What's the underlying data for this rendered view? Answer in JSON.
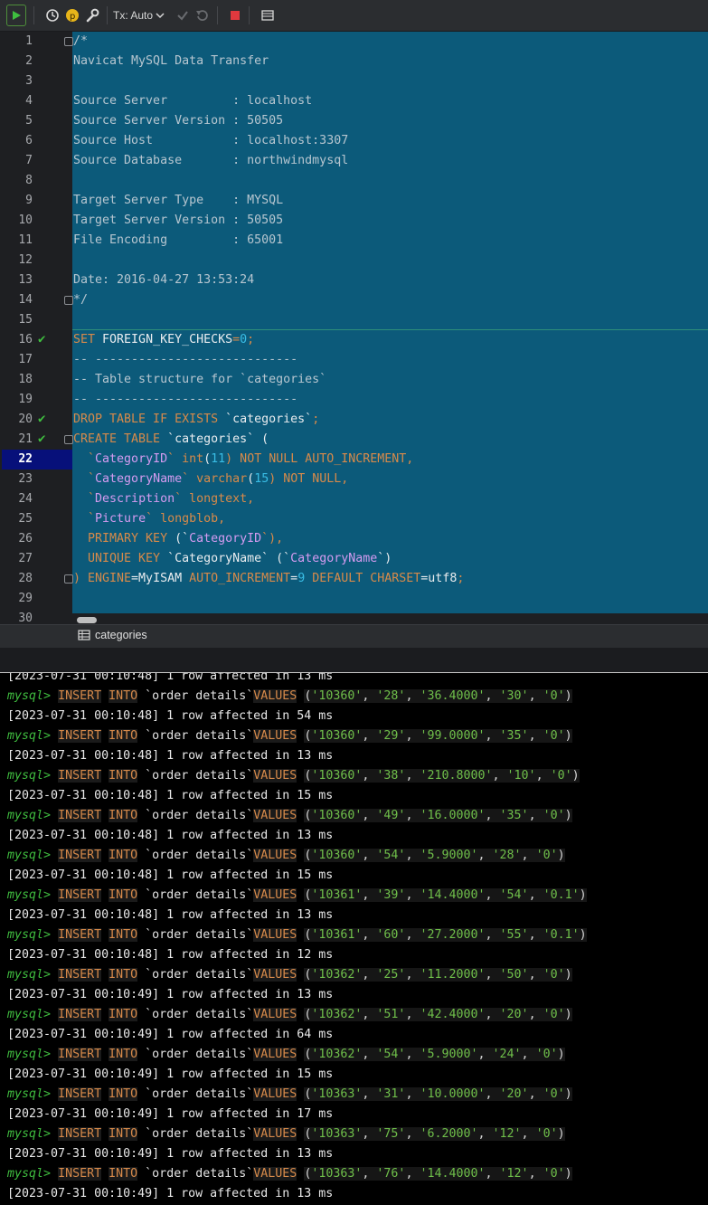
{
  "toolbar": {
    "tx_label": "Tx: Auto",
    "icons": [
      "run-icon",
      "history-icon",
      "p-icon",
      "wrench-icon",
      "chevron-down-icon",
      "commit-icon",
      "rollback-icon",
      "stop-icon",
      "table-icon"
    ]
  },
  "editor": {
    "line_numbers": [
      "1",
      "2",
      "3",
      "4",
      "5",
      "6",
      "7",
      "8",
      "9",
      "10",
      "11",
      "12",
      "13",
      "14",
      "15",
      "16",
      "17",
      "18",
      "19",
      "20",
      "21",
      "22",
      "23",
      "24",
      "25",
      "26",
      "27",
      "28",
      "29",
      "30"
    ],
    "current_line": "22",
    "lines": [
      [
        {
          "t": "/*",
          "c": "cm"
        }
      ],
      [
        {
          "t": "Navicat MySQL Data Transfer",
          "c": "cm"
        }
      ],
      [],
      [
        {
          "t": "Source Server         : localhost",
          "c": "cm"
        }
      ],
      [
        {
          "t": "Source Server Version : 50505",
          "c": "cm"
        }
      ],
      [
        {
          "t": "Source Host           : localhost:3307",
          "c": "cm"
        }
      ],
      [
        {
          "t": "Source Database       : northwindmysql",
          "c": "cm"
        }
      ],
      [],
      [
        {
          "t": "Target Server Type    : MYSQL",
          "c": "cm"
        }
      ],
      [
        {
          "t": "Target Server Version : 50505",
          "c": "cm"
        }
      ],
      [
        {
          "t": "File Encoding         : 65001",
          "c": "cm"
        }
      ],
      [],
      [
        {
          "t": "Date: 2016-04-27 13:53:24",
          "c": "cm"
        }
      ],
      [
        {
          "t": "*/",
          "c": "cm"
        }
      ],
      [],
      [
        {
          "t": "SET ",
          "c": "kw"
        },
        {
          "t": "FOREIGN_KEY_CHECKS",
          "c": "id"
        },
        {
          "t": "=",
          "c": "kw"
        },
        {
          "t": "0",
          "c": "nm"
        },
        {
          "t": ";",
          "c": "kw"
        }
      ],
      [
        {
          "t": "-- ----------------------------",
          "c": "cm"
        }
      ],
      [
        {
          "t": "-- Table structure for `categories`",
          "c": "cm"
        }
      ],
      [
        {
          "t": "-- ----------------------------",
          "c": "cm"
        }
      ],
      [
        {
          "t": "DROP TABLE IF EXISTS ",
          "c": "kw"
        },
        {
          "t": "`categories`",
          "c": "id"
        },
        {
          "t": ";",
          "c": "kw"
        }
      ],
      [
        {
          "t": "CREATE TABLE ",
          "c": "kw"
        },
        {
          "t": "`categories`",
          "c": "id"
        },
        {
          "t": " (",
          "c": "id"
        }
      ],
      [
        {
          "t": "  `",
          "c": "kw"
        },
        {
          "t": "CategoryID",
          "c": "bq"
        },
        {
          "t": "` ",
          "c": "kw"
        },
        {
          "t": "int",
          "c": "kw"
        },
        {
          "t": "(",
          "c": "id"
        },
        {
          "t": "11",
          "c": "nm"
        },
        {
          "t": ") NOT NULL AUTO_INCREMENT,",
          "c": "kw"
        }
      ],
      [
        {
          "t": "  `",
          "c": "kw"
        },
        {
          "t": "CategoryName",
          "c": "bq"
        },
        {
          "t": "` varchar",
          "c": "kw"
        },
        {
          "t": "(",
          "c": "id"
        },
        {
          "t": "15",
          "c": "nm"
        },
        {
          "t": ") NOT NULL,",
          "c": "kw"
        }
      ],
      [
        {
          "t": "  `",
          "c": "kw"
        },
        {
          "t": "Description",
          "c": "bq"
        },
        {
          "t": "` longtext,",
          "c": "kw"
        }
      ],
      [
        {
          "t": "  `",
          "c": "kw"
        },
        {
          "t": "Picture",
          "c": "bq"
        },
        {
          "t": "` longblob,",
          "c": "kw"
        }
      ],
      [
        {
          "t": "  PRIMARY KEY ",
          "c": "kw"
        },
        {
          "t": "(`",
          "c": "id"
        },
        {
          "t": "CategoryID",
          "c": "bq"
        },
        {
          "t": "`),",
          "c": "kw"
        }
      ],
      [
        {
          "t": "  UNIQUE KEY ",
          "c": "kw"
        },
        {
          "t": "`CategoryName` (`",
          "c": "id"
        },
        {
          "t": "CategoryName",
          "c": "bq"
        },
        {
          "t": "`)",
          "c": "id"
        }
      ],
      [
        {
          "t": ") ENGINE",
          "c": "kw"
        },
        {
          "t": "=MyISAM ",
          "c": "id"
        },
        {
          "t": "AUTO_INCREMENT",
          "c": "kw"
        },
        {
          "t": "=",
          "c": "id"
        },
        {
          "t": "9",
          "c": "nm"
        },
        {
          "t": " DEFAULT CHARSET",
          "c": "kw"
        },
        {
          "t": "=utf8",
          "c": "id"
        },
        {
          "t": ";",
          "c": "kw"
        }
      ],
      [],
      []
    ],
    "checked_lines": [
      "16",
      "20",
      "21"
    ]
  },
  "tabbar": {
    "tab_label": "categories"
  },
  "console": {
    "first_partial": "[2023-07-31 00:10:48] 1 row affected in 13 ms",
    "prompt": "mysql>",
    "insert_kw": "INSERT",
    "into_kw": "INTO",
    "table": "`order details`",
    "values_kw": "VALUES",
    "entries": [
      {
        "vals": [
          "'10360'",
          "'28'",
          "'36.4000'",
          "'30'",
          "'0'"
        ],
        "result": "[2023-07-31 00:10:48] 1 row affected in 54 ms"
      },
      {
        "vals": [
          "'10360'",
          "'29'",
          "'99.0000'",
          "'35'",
          "'0'"
        ],
        "result": "[2023-07-31 00:10:48] 1 row affected in 13 ms"
      },
      {
        "vals": [
          "'10360'",
          "'38'",
          "'210.8000'",
          "'10'",
          "'0'"
        ],
        "result": "[2023-07-31 00:10:48] 1 row affected in 15 ms"
      },
      {
        "vals": [
          "'10360'",
          "'49'",
          "'16.0000'",
          "'35'",
          "'0'"
        ],
        "result": "[2023-07-31 00:10:48] 1 row affected in 13 ms"
      },
      {
        "vals": [
          "'10360'",
          "'54'",
          "'5.9000'",
          "'28'",
          "'0'"
        ],
        "result": "[2023-07-31 00:10:48] 1 row affected in 15 ms"
      },
      {
        "vals": [
          "'10361'",
          "'39'",
          "'14.4000'",
          "'54'",
          "'0.1'"
        ],
        "result": "[2023-07-31 00:10:48] 1 row affected in 13 ms"
      },
      {
        "vals": [
          "'10361'",
          "'60'",
          "'27.2000'",
          "'55'",
          "'0.1'"
        ],
        "result": "[2023-07-31 00:10:48] 1 row affected in 12 ms"
      },
      {
        "vals": [
          "'10362'",
          "'25'",
          "'11.2000'",
          "'50'",
          "'0'"
        ],
        "result": "[2023-07-31 00:10:49] 1 row affected in 13 ms"
      },
      {
        "vals": [
          "'10362'",
          "'51'",
          "'42.4000'",
          "'20'",
          "'0'"
        ],
        "result": "[2023-07-31 00:10:49] 1 row affected in 64 ms"
      },
      {
        "vals": [
          "'10362'",
          "'54'",
          "'5.9000'",
          "'24'",
          "'0'"
        ],
        "result": "[2023-07-31 00:10:49] 1 row affected in 15 ms"
      },
      {
        "vals": [
          "'10363'",
          "'31'",
          "'10.0000'",
          "'20'",
          "'0'"
        ],
        "result": "[2023-07-31 00:10:49] 1 row affected in 17 ms"
      },
      {
        "vals": [
          "'10363'",
          "'75'",
          "'6.2000'",
          "'12'",
          "'0'"
        ],
        "result": "[2023-07-31 00:10:49] 1 row affected in 13 ms"
      },
      {
        "vals": [
          "'10363'",
          "'76'",
          "'14.4000'",
          "'12'",
          "'0'"
        ],
        "result": "[2023-07-31 00:10:49] 1 row affected in 13 ms"
      }
    ]
  }
}
